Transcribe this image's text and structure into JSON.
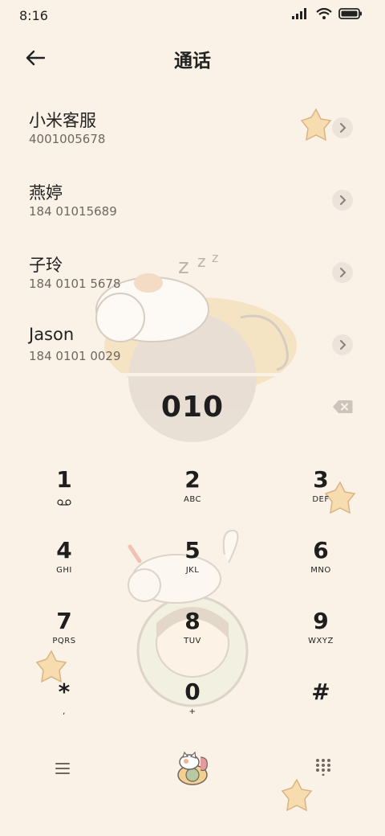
{
  "status_bar": {
    "time": "8:16"
  },
  "header": {
    "title": "通话"
  },
  "results": [
    {
      "name": "小米客服",
      "number": "4001005678"
    },
    {
      "name": "燕婷",
      "number": "184 01015689"
    },
    {
      "name": "子玲",
      "number": "184 0101 5678"
    },
    {
      "name": "Jason",
      "number": "184 0101 0029"
    }
  ],
  "dialer": {
    "input": "010"
  },
  "keypad": [
    {
      "digit": "1",
      "letters": ""
    },
    {
      "digit": "2",
      "letters": "ABC"
    },
    {
      "digit": "3",
      "letters": "DEF"
    },
    {
      "digit": "4",
      "letters": "GHI"
    },
    {
      "digit": "5",
      "letters": "JKL"
    },
    {
      "digit": "6",
      "letters": "MNO"
    },
    {
      "digit": "7",
      "letters": "PQRS"
    },
    {
      "digit": "8",
      "letters": "TUV"
    },
    {
      "digit": "9",
      "letters": "WXYZ"
    },
    {
      "digit": "*",
      "letters": ","
    },
    {
      "digit": "0",
      "letters": "+"
    },
    {
      "digit": "#",
      "letters": ""
    }
  ],
  "icons": {
    "back": "arrow-left-icon",
    "chevron": "chevron-right-icon",
    "backspace": "backspace-icon",
    "voicemail": "voicemail-icon",
    "menu": "menu-icon",
    "dial": "cat-dial-icon",
    "keypad_toggle": "dialpad-icon"
  }
}
